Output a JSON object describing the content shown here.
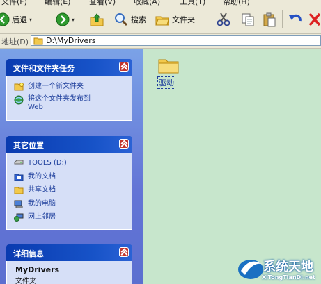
{
  "menubar": {
    "items": [
      "文件(F)",
      "编辑(E)",
      "查看(V)",
      "收藏(A)",
      "工具(T)",
      "帮助(H)"
    ]
  },
  "toolbar": {
    "back_label": "后退",
    "search_label": "搜索",
    "folders_label": "文件夹"
  },
  "address": {
    "label": "地址(D)",
    "path": "D:\\MyDrivers"
  },
  "tasks_panel": {
    "title": "文件和文件夹任务",
    "items": [
      {
        "label": "创建一个新文件夹",
        "icon": "new-folder-icon"
      },
      {
        "label": "将这个文件夹发布到",
        "label2": "Web",
        "icon": "publish-web-icon"
      }
    ]
  },
  "places_panel": {
    "title": "其它位置",
    "items": [
      {
        "label": "TOOLS (D:)",
        "icon": "drive-icon"
      },
      {
        "label": "我的文档",
        "icon": "my-documents-icon"
      },
      {
        "label": "共享文档",
        "icon": "shared-documents-icon"
      },
      {
        "label": "我的电脑",
        "icon": "my-computer-icon"
      },
      {
        "label": "网上邻居",
        "icon": "network-places-icon"
      }
    ]
  },
  "details_panel": {
    "title": "详细信息",
    "name": "MyDrivers",
    "type": "文件夹"
  },
  "content": {
    "folder_name": "驱动"
  },
  "watermark": {
    "main": "系统天地",
    "sub": "XiTongTianDi.net"
  },
  "colors": {
    "content_bg": "#c7e6cc",
    "taskpane_header": "#1753c8",
    "link_text": "#1e3f9c"
  }
}
